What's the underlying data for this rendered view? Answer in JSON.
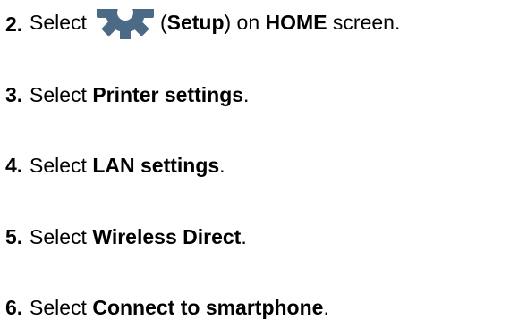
{
  "steps": [
    {
      "number": "2.",
      "prefix": "Select",
      "icon": "gear-icon",
      "open_paren": "(",
      "bold": "Setup",
      "close_paren": ")",
      "middle": " on ",
      "bold2": "HOME",
      "suffix": " screen."
    },
    {
      "number": "3.",
      "prefix": "Select ",
      "bold": "Printer settings",
      "suffix": "."
    },
    {
      "number": "4.",
      "prefix": "Select ",
      "bold": "LAN settings",
      "suffix": "."
    },
    {
      "number": "5.",
      "prefix": "Select ",
      "bold": "Wireless Direct",
      "suffix": "."
    },
    {
      "number": "6.",
      "prefix": "Select ",
      "bold": "Connect to smartphone",
      "suffix": "."
    }
  ],
  "colors": {
    "text": "#000000",
    "icon_gear": "#4a6a86",
    "background": "#ffffff"
  }
}
